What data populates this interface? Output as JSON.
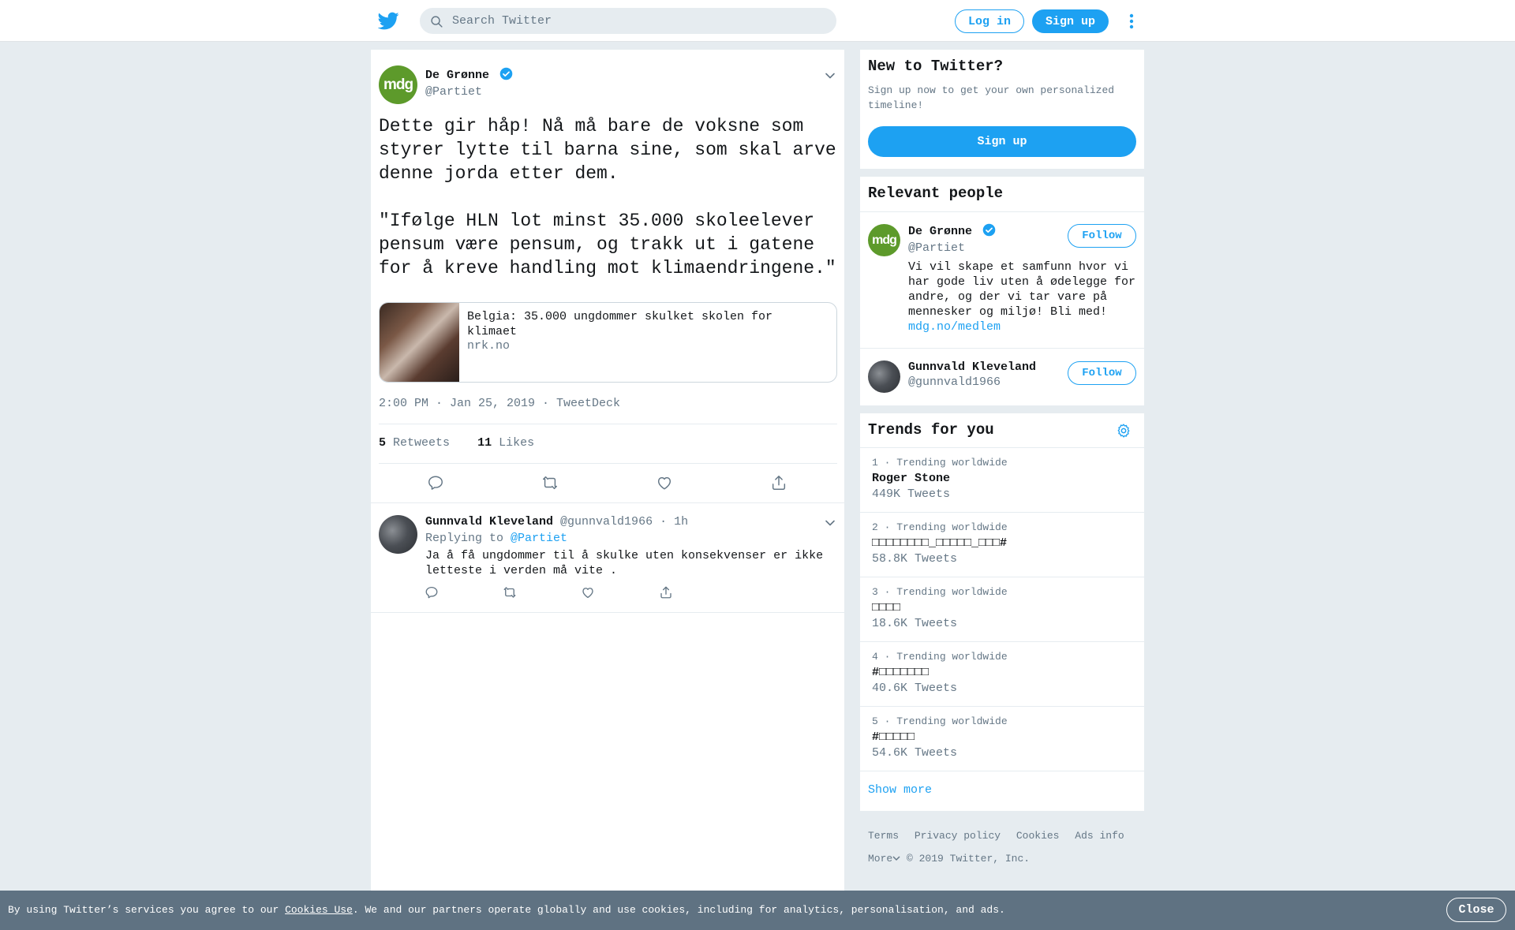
{
  "header": {
    "logo": "twitter-bird-icon",
    "search_placeholder": "Search Twitter",
    "login_label": "Log in",
    "signup_label": "Sign up"
  },
  "tweet": {
    "author_name": "De Grønne",
    "author_handle": "@Partiet",
    "avatar_text": "mdg",
    "text": "Dette gir håp! Nå må bare de voksne som\nstyrer lytte til barna sine, som skal arve\ndenne jorda etter dem.\n\n\"Ifølge HLN lot minst 35.000 skoleelever\npensum være pensum, og trakk ut i gatene\nfor å kreve handling mot klimaendringene.\"",
    "card": {
      "title": "Belgia: 35.000 ungdommer skulket skolen for klimaet",
      "domain": "nrk.no"
    },
    "timestamp": "2:00 PM · Jan 25, 2019 · TweetDeck",
    "retweets_count": "5",
    "retweets_label": "Retweets",
    "likes_count": "11",
    "likes_label": "Likes"
  },
  "reply": {
    "author_name": "Gunnvald Kleveland",
    "author_handle": "@gunnvald1966",
    "time": "· 1h",
    "replying_to_label": "Replying to",
    "replying_to_handle": "@Partiet",
    "text": "Ja å få ungdommer til å skulke uten konsekvenser er ikke letteste i verden må vite ."
  },
  "signup_box": {
    "title": "New to Twitter?",
    "subtitle": "Sign up now to get your own personalized timeline!",
    "button": "Sign up"
  },
  "relevant": {
    "title": "Relevant people",
    "people": [
      {
        "name": "De Grønne",
        "handle": "@Partiet",
        "bio": "Vi vil skape et samfunn hvor vi har gode liv uten å ødelegge for andre, og der vi tar vare på mennesker og miljø! Bli med!",
        "link": "mdg.no/medlem",
        "follow": "Follow"
      },
      {
        "name": "Gunnvald Kleveland",
        "handle": "@gunnvald1966",
        "follow": "Follow"
      }
    ]
  },
  "trends": {
    "title": "Trends for you",
    "items": [
      {
        "meta": "1 · Trending worldwide",
        "name": "Roger Stone",
        "count": "449K Tweets"
      },
      {
        "meta": "2 · Trending worldwide",
        "name": "□□□□□□□□_□□□□□_□□□#",
        "count": "58.8K Tweets"
      },
      {
        "meta": "3 · Trending worldwide",
        "name": "□□□□",
        "count": "18.6K Tweets"
      },
      {
        "meta": "4 · Trending worldwide",
        "name": "#□□□□□□□",
        "count": "40.6K Tweets"
      },
      {
        "meta": "5 · Trending worldwide",
        "name": "#□□□□□",
        "count": "54.6K Tweets"
      }
    ],
    "show_more": "Show more"
  },
  "footer": {
    "links": [
      "Terms",
      "Privacy policy",
      "Cookies",
      "Ads info"
    ],
    "more": "More",
    "copyright": "© 2019 Twitter, Inc."
  },
  "cookie_bar": {
    "text_before": "By using Twitter’s services you agree to our ",
    "link": "Cookies Use",
    "text_after": ". We and our partners operate globally and use cookies, including for analytics, personalisation, and ads.",
    "close": "Close"
  },
  "colors": {
    "accent": "#1da1f2",
    "mdg_green": "#5d9a2b",
    "background": "#e6ecf0",
    "cookie_bar": "#5f7282"
  }
}
